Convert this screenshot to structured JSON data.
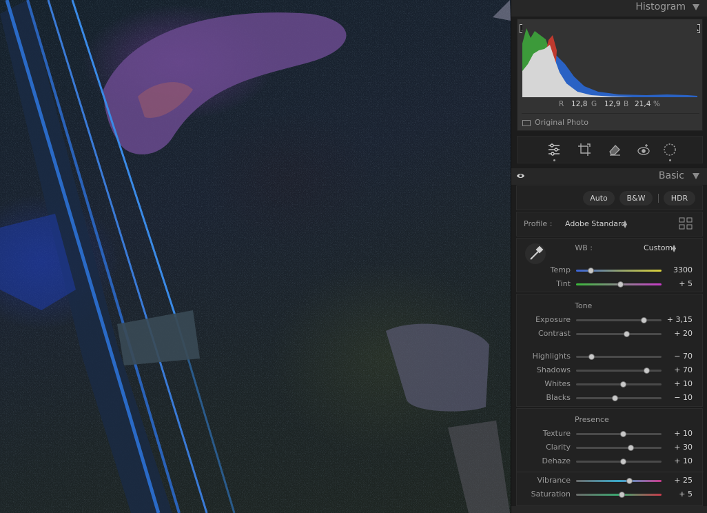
{
  "histogram": {
    "title": "Histogram",
    "r_label": "R",
    "r_value": "12,8",
    "g_label": "G",
    "g_value": "12,9",
    "b_label": "B",
    "b_value": "21,4",
    "percent": "%",
    "original_photo": "Original Photo"
  },
  "tools": [
    "edit-sliders-icon",
    "crop-icon",
    "heal-eraser-icon",
    "redeye-icon",
    "mask-icon"
  ],
  "basic": {
    "title": "Basic",
    "auto": "Auto",
    "bw": "B&W",
    "hdr": "HDR",
    "profile_label": "Profile :",
    "profile_value": "Adobe Standard",
    "wb_label": "WB :",
    "wb_value": "Custom"
  },
  "sliders": {
    "temp": {
      "label": "Temp",
      "value": "3300",
      "pos": 0.17
    },
    "tint": {
      "label": "Tint",
      "value": "+ 5",
      "pos": 0.52
    },
    "tone_title": "Tone",
    "exposure": {
      "label": "Exposure",
      "value": "+ 3,15",
      "pos": 0.79
    },
    "contrast": {
      "label": "Contrast",
      "value": "+ 20",
      "pos": 0.59
    },
    "highlights": {
      "label": "Highlights",
      "value": "− 70",
      "pos": 0.18
    },
    "shadows": {
      "label": "Shadows",
      "value": "+ 70",
      "pos": 0.82
    },
    "whites": {
      "label": "Whites",
      "value": "+ 10",
      "pos": 0.55
    },
    "blacks": {
      "label": "Blacks",
      "value": "− 10",
      "pos": 0.45
    },
    "presence_title": "Presence",
    "texture": {
      "label": "Texture",
      "value": "+ 10",
      "pos": 0.55
    },
    "clarity": {
      "label": "Clarity",
      "value": "+ 30",
      "pos": 0.64
    },
    "dehaze": {
      "label": "Dehaze",
      "value": "+ 10",
      "pos": 0.55
    },
    "vibrance": {
      "label": "Vibrance",
      "value": "+ 25",
      "pos": 0.62
    },
    "saturation": {
      "label": "Saturation",
      "value": "+ 5",
      "pos": 0.53
    }
  },
  "colors": {
    "panel_bg": "#1c1c1c",
    "section_bg": "#222222",
    "hist_blue": "#2a62c4",
    "hist_green": "#3c9a3a",
    "hist_red": "#c03a2e",
    "hist_gray": "#d6d6d6"
  }
}
